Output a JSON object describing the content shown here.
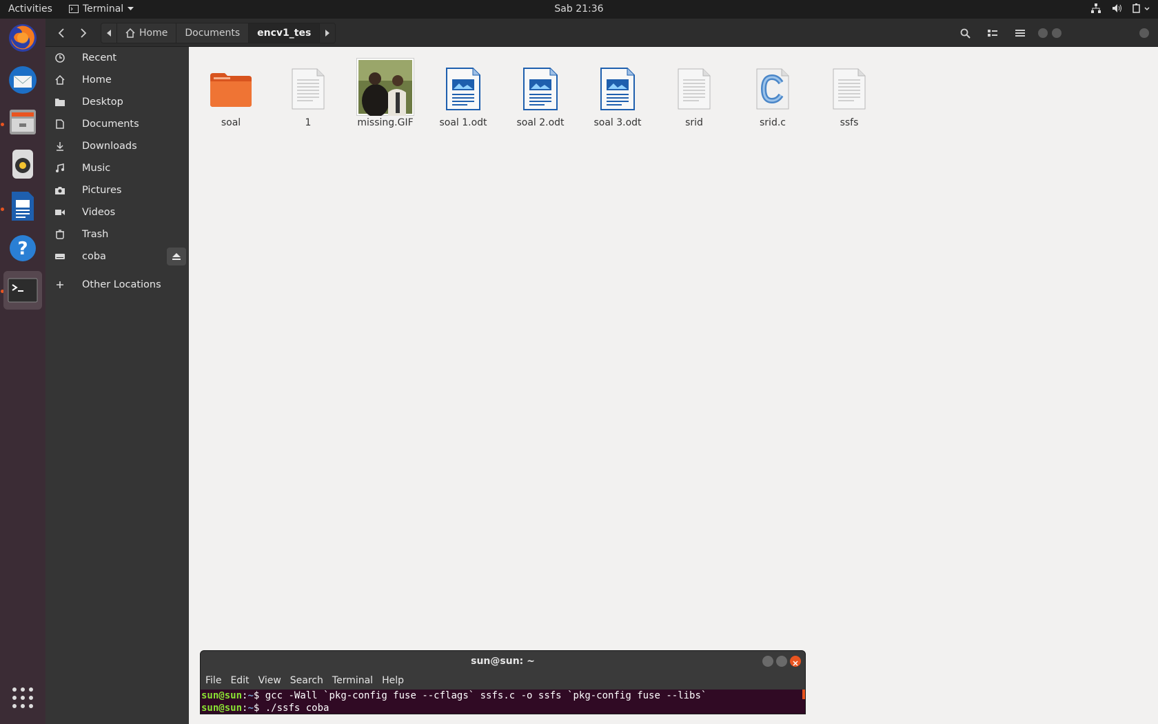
{
  "topbar": {
    "activities": "Activities",
    "app_name": "Terminal",
    "clock": "Sab 21:36"
  },
  "dock": {
    "items": [
      "Firefox",
      "Thunderbird",
      "Files",
      "Rhythmbox",
      "LibreOffice Writer",
      "Help",
      "Terminal"
    ]
  },
  "files": {
    "breadcrumbs": [
      "Home",
      "Documents",
      "encv1_tes"
    ],
    "sidebar": [
      {
        "label": "Recent",
        "icon": "clock-icon"
      },
      {
        "label": "Home",
        "icon": "home-icon"
      },
      {
        "label": "Desktop",
        "icon": "folder-icon"
      },
      {
        "label": "Documents",
        "icon": "document-icon"
      },
      {
        "label": "Downloads",
        "icon": "download-icon"
      },
      {
        "label": "Music",
        "icon": "music-icon"
      },
      {
        "label": "Pictures",
        "icon": "camera-icon"
      },
      {
        "label": "Videos",
        "icon": "video-icon"
      },
      {
        "label": "Trash",
        "icon": "trash-icon"
      },
      {
        "label": "coba",
        "icon": "drive-icon"
      },
      {
        "label": "Other Locations",
        "icon": "plus-icon"
      }
    ],
    "items": [
      {
        "name": "soal",
        "type": "folder"
      },
      {
        "name": "1",
        "type": "text"
      },
      {
        "name": "missing.GIF",
        "type": "image"
      },
      {
        "name": "soal 1.odt",
        "type": "odt"
      },
      {
        "name": "soal 2.odt",
        "type": "odt"
      },
      {
        "name": "soal 3.odt",
        "type": "odt"
      },
      {
        "name": "srid",
        "type": "text"
      },
      {
        "name": "srid.c",
        "type": "c-source"
      },
      {
        "name": "ssfs",
        "type": "text"
      }
    ]
  },
  "terminal": {
    "title": "sun@sun: ~",
    "menu": [
      "File",
      "Edit",
      "View",
      "Search",
      "Terminal",
      "Help"
    ],
    "lines": [
      {
        "user": "sun@sun",
        "sep": ":",
        "path": "~",
        "prompt": "$ ",
        "cmd": "gcc -Wall `pkg-config fuse --cflags` ssfs.c -o ssfs `pkg-config fuse --libs`"
      },
      {
        "user": "sun@sun",
        "sep": ":",
        "path": "~",
        "prompt": "$ ",
        "cmd": "./ssfs coba"
      }
    ]
  },
  "colors": {
    "accent": "#e95420",
    "terminal_bg": "#300a24",
    "folder": "#e9622b"
  }
}
